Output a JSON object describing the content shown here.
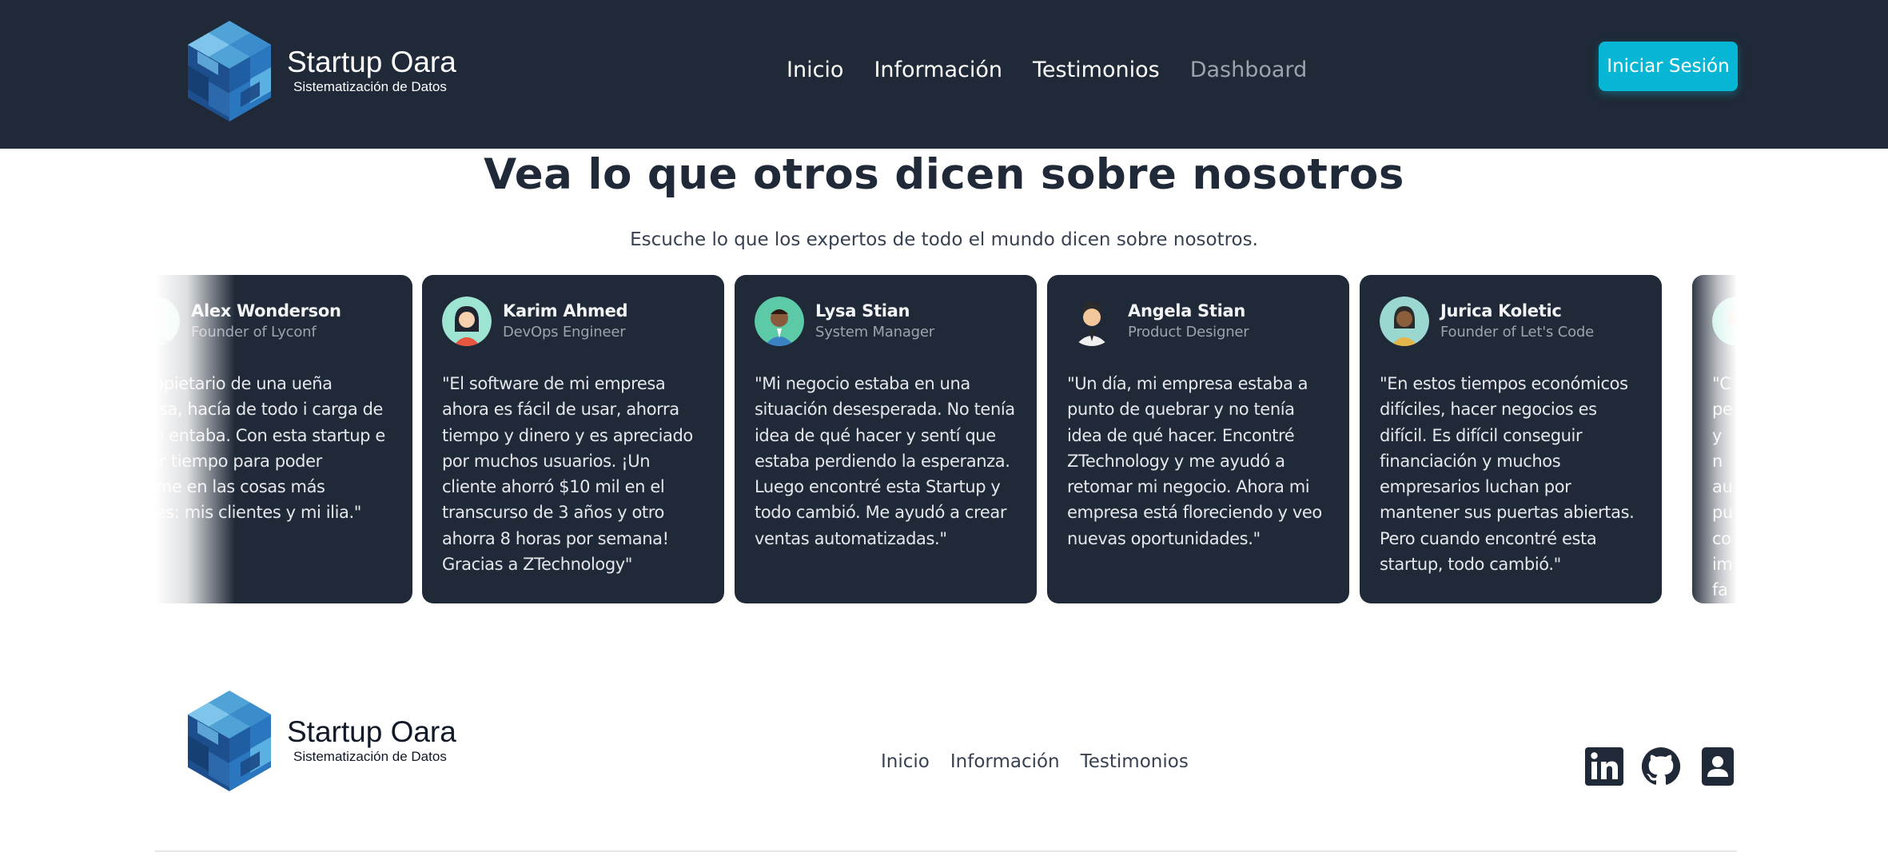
{
  "brand": {
    "title": "Startup Oara",
    "subtitle": "Sistematización de Datos"
  },
  "header": {
    "nav": [
      "Inicio",
      "Información",
      "Testimonios",
      "Dashboard"
    ],
    "login_label": "Iniciar Sesión"
  },
  "section": {
    "title": "Vea lo que otros dicen sobre nosotros",
    "subtitle": "Escuche lo que los expertos de todo el mundo dicen sobre nosotros."
  },
  "testimonials": [
    {
      "name": "Alex Wonderson",
      "role": "Founder of Lyconf",
      "quote": "mo propietario de una ueña empresa, hacía de todo i carga de trabajo entaba. Con esta startup e ahorrar tiempo para poder entrarme en las cosas más ortantes: mis clientes y mi ilia.\""
    },
    {
      "name": "Karim Ahmed",
      "role": "DevOps Engineer",
      "quote": "\"El software de mi empresa ahora es fácil de usar, ahorra tiempo y dinero y es apreciado por muchos usuarios. ¡Un cliente ahorró $10 mil en el transcurso de 3 años y otro ahorra 8 horas por semana! Gracias a ZTechnology\""
    },
    {
      "name": "Lysa Stian",
      "role": "System Manager",
      "quote": "\"Mi negocio estaba en una situación desesperada. No tenía idea de qué hacer y sentí que estaba perdiendo la esperanza. Luego encontré esta Startup y todo cambió. Me ayudó a crear ventas automatizadas.\""
    },
    {
      "name": "Angela Stian",
      "role": "Product Designer",
      "quote": "\"Un día, mi empresa estaba a punto de quebrar y no tenía idea de qué hacer. Encontré ZTechnology y me ayudó a retomar mi negocio. Ahora mi empresa está floreciendo y veo nuevas oportunidades.\""
    },
    {
      "name": "Jurica Koletic",
      "role": "Founder of Let's Code",
      "quote": "\"En estos tiempos económicos difíciles, hacer negocios es difícil. Es difícil conseguir financiación y muchos empresarios luchan por mantener sus puertas abiertas. Pero cuando encontré esta startup, todo cambió.\""
    },
    {
      "name": "",
      "role": "",
      "quote": "\"C pe y n au pu co im fa"
    }
  ],
  "footer": {
    "nav": [
      "Inicio",
      "Información",
      "Testimonios"
    ],
    "social_icons": [
      "linkedin-icon",
      "github-icon",
      "contact-card-icon"
    ]
  },
  "colors": {
    "navy": "#1f2937",
    "accent": "#06b6d4",
    "muted": "#9ca3af"
  }
}
